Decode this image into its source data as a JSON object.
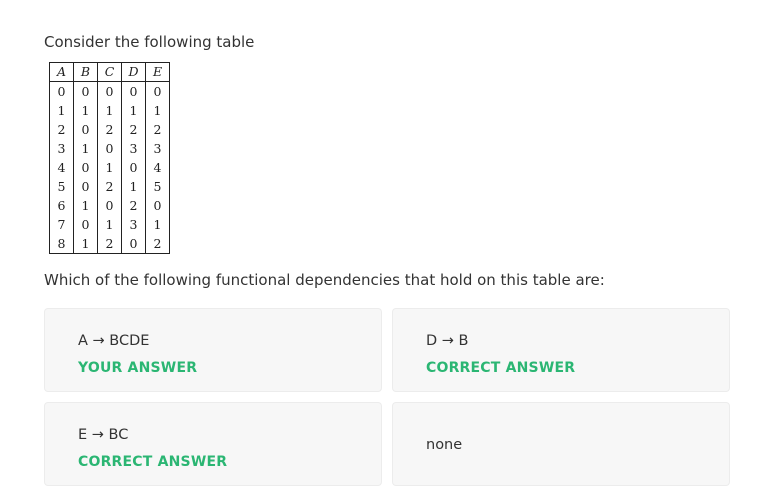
{
  "question": {
    "intro": "Consider the following table",
    "prompt": "Which of the following functional dependencies that hold on this table are:"
  },
  "table": {
    "headers": [
      "A",
      "B",
      "C",
      "D",
      "E"
    ],
    "rows": [
      [
        "0",
        "0",
        "0",
        "0",
        "0"
      ],
      [
        "1",
        "1",
        "1",
        "1",
        "1"
      ],
      [
        "2",
        "0",
        "2",
        "2",
        "2"
      ],
      [
        "3",
        "1",
        "0",
        "3",
        "3"
      ],
      [
        "4",
        "0",
        "1",
        "0",
        "4"
      ],
      [
        "5",
        "0",
        "2",
        "1",
        "5"
      ],
      [
        "6",
        "1",
        "0",
        "2",
        "0"
      ],
      [
        "7",
        "0",
        "1",
        "3",
        "1"
      ],
      [
        "8",
        "1",
        "2",
        "0",
        "2"
      ]
    ]
  },
  "options": [
    {
      "label": "A → BCDE",
      "status": "YOUR ANSWER"
    },
    {
      "label": "D → B",
      "status": "CORRECT ANSWER"
    },
    {
      "label": "E → BC",
      "status": "CORRECT ANSWER"
    },
    {
      "label": "none",
      "status": ""
    }
  ],
  "colors": {
    "status_green": "#2bb673",
    "card_background": "#f7f7f7",
    "text": "#333333"
  }
}
